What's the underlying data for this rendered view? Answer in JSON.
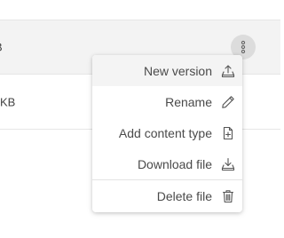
{
  "table": {
    "rows": [
      {
        "size": "B"
      },
      {
        "size": "KB"
      }
    ]
  },
  "menu": {
    "items": [
      {
        "label": "New version",
        "icon": "upload-icon"
      },
      {
        "label": "Rename",
        "icon": "pencil-icon"
      },
      {
        "label": "Add content type",
        "icon": "file-plus-icon"
      },
      {
        "label": "Download file",
        "icon": "download-icon"
      },
      {
        "label": "Delete file",
        "icon": "trash-icon"
      }
    ]
  },
  "colors": {
    "menu_text": "#4a4a4a",
    "highlight": "#f4f4f4",
    "row_selected": "#f3f3f3",
    "kebab_background": "#dcdcdc"
  }
}
